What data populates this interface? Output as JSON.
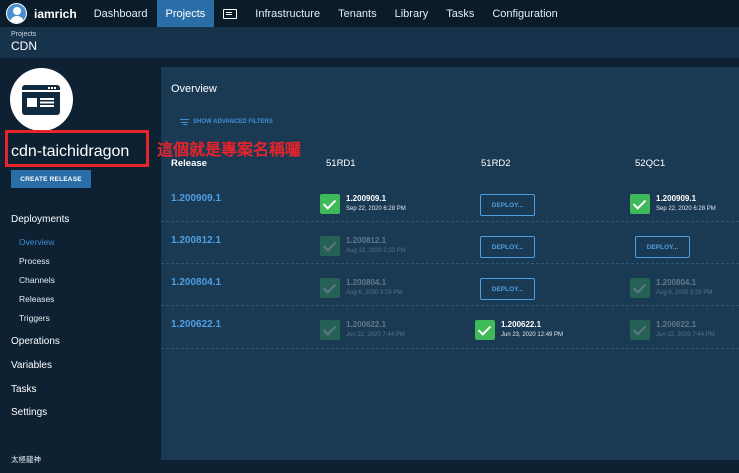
{
  "nav": {
    "user": "iamrich",
    "items": [
      "Dashboard",
      "Projects",
      "Infrastructure",
      "Tenants",
      "Library",
      "Tasks",
      "Configuration"
    ],
    "active": "Projects"
  },
  "breadcrumb": {
    "parent": "Projects",
    "current": "CDN"
  },
  "project": {
    "name": "cdn-taichidragon",
    "create_release_label": "CREATE RELEASE"
  },
  "annotation": "這個就是專案名稱囉",
  "sidebar": {
    "deployments": "Deployments",
    "items": [
      "Overview",
      "Process",
      "Channels",
      "Releases",
      "Triggers"
    ],
    "operations": "Operations",
    "variables": "Variables",
    "tasks": "Tasks",
    "settings": "Settings",
    "footer": "太極龍神"
  },
  "overview": {
    "title": "Overview",
    "filters_label": "SHOW ADVANCED FILTERS",
    "columns": [
      "Release",
      "51RD1",
      "51RD2",
      "52QC1"
    ],
    "deploy_label": "DEPLOY...",
    "rows": [
      {
        "release": "1.200909.1",
        "cells": [
          {
            "type": "success",
            "version": "1.200909.1",
            "date": "Sep 22, 2020 6:28 PM",
            "faded": false
          },
          {
            "type": "deploy"
          },
          {
            "type": "success",
            "version": "1.200909.1",
            "date": "Sep 22, 2020 6:28 PM",
            "faded": false
          }
        ]
      },
      {
        "release": "1.200812.1",
        "cells": [
          {
            "type": "success",
            "version": "1.200812.1",
            "date": "Aug 12, 2020 2:32 PM",
            "faded": true
          },
          {
            "type": "deploy"
          },
          {
            "type": "deploy"
          }
        ]
      },
      {
        "release": "1.200804.1",
        "cells": [
          {
            "type": "success",
            "version": "1.200804.1",
            "date": "Aug 6, 2020 3:29 PM",
            "faded": true
          },
          {
            "type": "deploy"
          },
          {
            "type": "success",
            "version": "1.200804.1",
            "date": "Aug 6, 2020 3:29 PM",
            "faded": true
          }
        ]
      },
      {
        "release": "1.200622.1",
        "cells": [
          {
            "type": "success",
            "version": "1.200622.1",
            "date": "Jun 22, 2020 7:44 PM",
            "faded": true
          },
          {
            "type": "success",
            "version": "1.200622.1",
            "date": "Jun 23, 2020 12:49 PM",
            "faded": false
          },
          {
            "type": "success",
            "version": "1.200622.1",
            "date": "Jun 22, 2020 7:44 PM",
            "faded": true
          }
        ]
      }
    ]
  },
  "colors": {
    "accent": "#2a6ea8",
    "link": "#4f9ee2",
    "success": "#3fba58",
    "annotation": "#e8232a"
  }
}
